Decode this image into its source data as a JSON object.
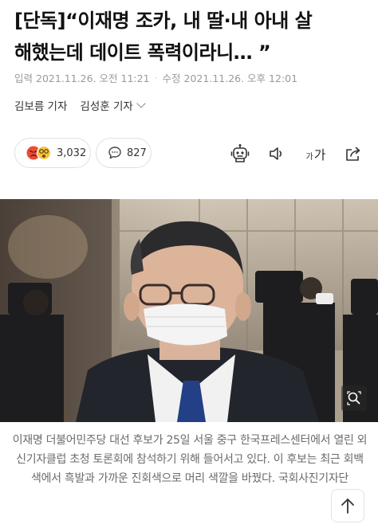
{
  "article": {
    "headline_line1": "[단독]“이재명 조카, 내 딸·내 아내 살",
    "headline_line2": "해했는데 데이트 폭력이라니… ”",
    "published_label": "입력",
    "published_time": "2021.11.26. 오전 11:21",
    "modified_label": "수정",
    "modified_time": "2021.11.26. 오후 12:01",
    "reporters": [
      "김보름 기자",
      "김성훈 기자"
    ]
  },
  "actions": {
    "reaction_count": "3,032",
    "comment_count": "827",
    "font_size_small": "가",
    "font_size_large": "가"
  },
  "icons": {
    "reactions": "angry-wow-emoji-icon",
    "comments": "speech-bubble-icon",
    "summary": "robot-icon",
    "tts": "speaker-icon",
    "font": "font-size-icon",
    "share": "share-icon",
    "zoom": "zoom-icon",
    "top": "arrow-up-icon"
  },
  "photo": {
    "caption": "이재명 더불어민주당 대선 후보가 25일 서울 중구 한국프레스센터에서 열린 외신기자클럽 초청 토론회에 참석하기 위해 들어서고 있다. 이 후보는 최근 회백색에서 흑발과 가까운 진회색으로 머리 색깔을 바꿨다. 국회사진기자단"
  },
  "colors": {
    "reaction_angry": "#ee4a36",
    "reaction_wow": "#f5c33b",
    "meta_text": "#9a9a9a",
    "caption_text": "#6b6b6b"
  }
}
